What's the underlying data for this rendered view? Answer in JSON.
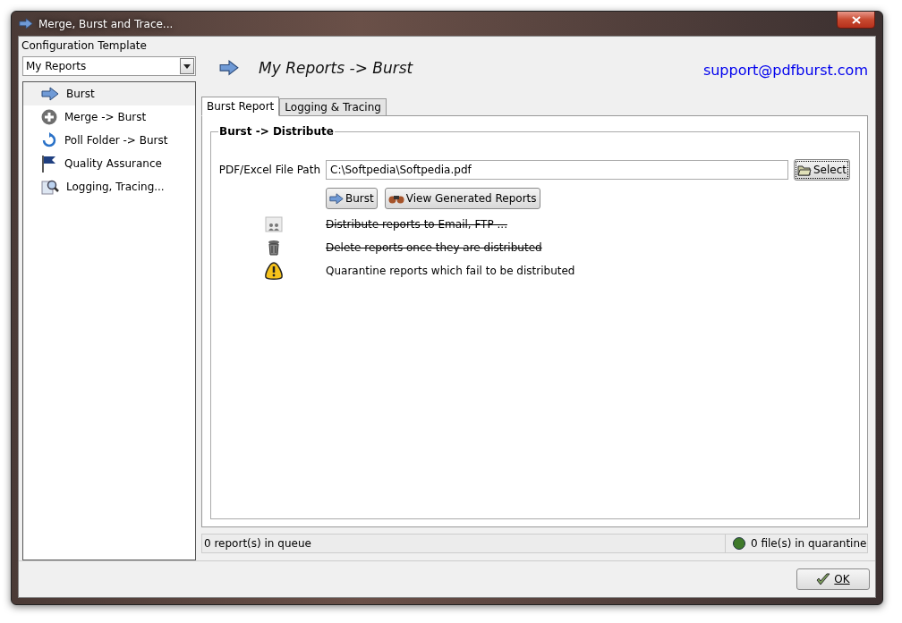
{
  "window": {
    "title": "Merge, Burst and Trace..."
  },
  "sidebar": {
    "label": "Configuration Template",
    "template": "My Reports",
    "items": [
      {
        "label": "Burst",
        "kind": "burst",
        "selected": true
      },
      {
        "label": "Merge -> Burst",
        "kind": "merge",
        "selected": false
      },
      {
        "label": "Poll Folder -> Burst",
        "kind": "poll",
        "selected": false
      },
      {
        "label": "Quality Assurance",
        "kind": "quality",
        "selected": false
      },
      {
        "label": "Logging, Tracing...",
        "kind": "logging",
        "selected": false
      }
    ]
  },
  "header": {
    "title": "My Reports -> Burst",
    "email": "support@pdfburst.com"
  },
  "tabs": [
    {
      "label": "Burst Report",
      "selected": true
    },
    {
      "label": "Logging & Tracing",
      "selected": false
    }
  ],
  "group": {
    "title": "Burst -> Distribute",
    "path_label": "PDF/Excel File Path",
    "path_value": "C:\\Softpedia\\Softpedia.pdf",
    "select_button": "Select",
    "buttons": [
      {
        "label": "Burst",
        "kind": "burst"
      },
      {
        "label": "View Generated Reports",
        "kind": "view"
      }
    ],
    "options": [
      {
        "label": "Distribute reports to Email, FTP ...",
        "kind": "distribute",
        "enabled": false
      },
      {
        "label": "Delete reports once they are distributed",
        "kind": "delete",
        "enabled": false
      },
      {
        "label": "Quarantine reports which fail to be distributed",
        "kind": "quarantine",
        "enabled": true
      }
    ]
  },
  "status_bar": {
    "queue": "0 report(s) in queue",
    "quarantine": "0 file(s) in quarantine",
    "color": "#3f7a2a"
  },
  "ok_button": "OK"
}
